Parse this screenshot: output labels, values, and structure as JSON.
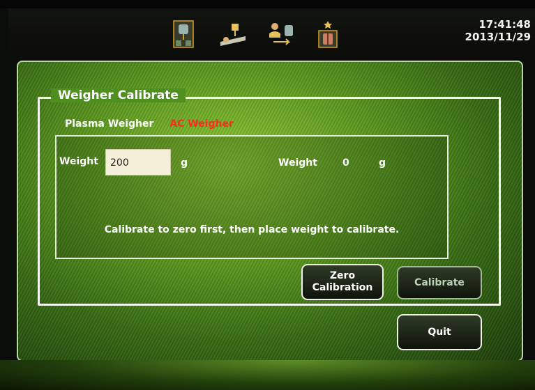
{
  "header": {
    "icons": [
      "collection-bag-icon",
      "patient-bed-icon",
      "transfer-icon",
      "cell-separator-icon"
    ],
    "time": "17:41:48",
    "date": "2013/11/29"
  },
  "dialog": {
    "title": "Weigher Calibrate",
    "tabs": [
      {
        "label": "Plasma Weigher",
        "active": false
      },
      {
        "label": "AC Weigher",
        "active": true
      }
    ],
    "input_weight_label": "Weight",
    "input_weight_value": "200",
    "input_unit": "g",
    "reading_label": "Weight",
    "reading_value": "0",
    "reading_unit": "g",
    "instruction": "Calibrate to zero first, then place weight to calibrate.",
    "zero_button_line1": "Zero",
    "zero_button_line2": "Calibration",
    "calibrate_button": "Calibrate"
  },
  "quit_button": "Quit",
  "colors": {
    "active_tab": "#ff2a1e",
    "panel_green": "#5d9a1f",
    "border": "#f3f7ee"
  }
}
